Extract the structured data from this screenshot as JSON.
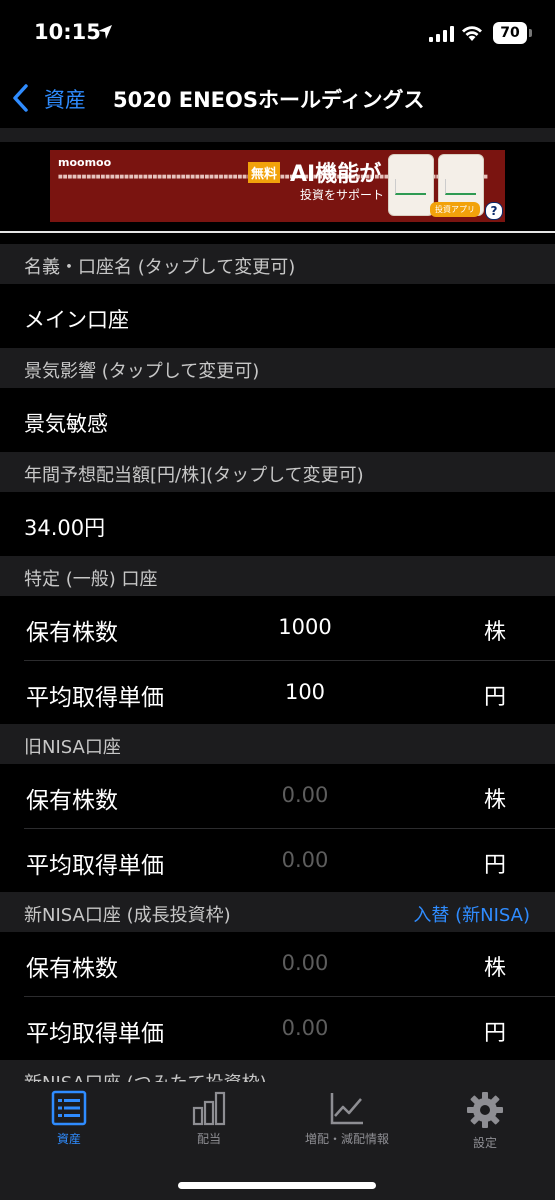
{
  "status_bar": {
    "time": "10:15",
    "battery": "70"
  },
  "nav": {
    "back_label": "資産",
    "title": "5020 ENEOSホールディングス"
  },
  "ad": {
    "brand": "moomoo",
    "badge": "無料",
    "headline": "AI機能が",
    "subline": "投資をサポート",
    "button": "投資アプリ",
    "help": "?"
  },
  "fields": {
    "account_name": {
      "label": "名義・口座名 (タップして変更可)",
      "value": "メイン口座"
    },
    "economic_impact": {
      "label": "景気影響 (タップして変更可)",
      "value": "景気敏感"
    },
    "dividend": {
      "label": "年間予想配当額[円/株](タップして変更可)",
      "value": "34.00円"
    }
  },
  "accounts": [
    {
      "header": "特定 (一般) 口座",
      "link": "",
      "shares": {
        "label": "保有株数",
        "value": "1000",
        "unit": "株"
      },
      "avg_price": {
        "label": "平均取得単価",
        "value": "100",
        "unit": "円"
      }
    },
    {
      "header": "旧NISA口座",
      "link": "",
      "shares": {
        "label": "保有株数",
        "value": "0.00",
        "unit": "株"
      },
      "avg_price": {
        "label": "平均取得単価",
        "value": "0.00",
        "unit": "円"
      }
    },
    {
      "header": "新NISA口座 (成長投資枠)",
      "link": "入替 (新NISA)",
      "shares": {
        "label": "保有株数",
        "value": "0.00",
        "unit": "株"
      },
      "avg_price": {
        "label": "平均取得単価",
        "value": "0.00",
        "unit": "円"
      }
    },
    {
      "header": "新NISA口座 (つみたて投資枠)"
    }
  ],
  "tabbar": [
    {
      "label": "資産",
      "icon": "list-icon",
      "active": true
    },
    {
      "label": "配当",
      "icon": "bar-chart-icon",
      "active": false
    },
    {
      "label": "増配・減配情報",
      "icon": "line-chart-icon",
      "active": false
    },
    {
      "label": "設定",
      "icon": "gear-icon",
      "active": false
    }
  ],
  "colors": {
    "accent": "#2f8cff",
    "band": "#1c1c1e",
    "background": "#000000",
    "placeholder": "#5d5d5d"
  }
}
